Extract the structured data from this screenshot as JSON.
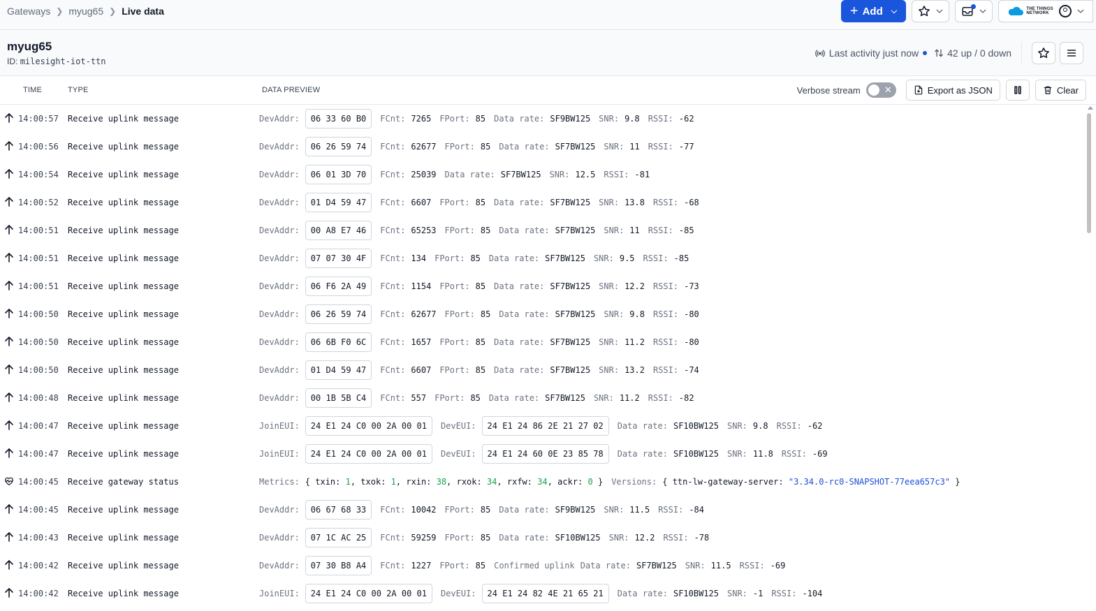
{
  "breadcrumb": {
    "items": [
      "Gateways",
      "myug65"
    ],
    "current": "Live data"
  },
  "topbar": {
    "add_label": "Add",
    "brand_text_line1": "THE THINGS",
    "brand_text_line2": "NETWORK"
  },
  "gateway": {
    "name": "myug65",
    "id_label": "ID:",
    "id_value": "milesight-iot-ttn"
  },
  "status": {
    "activity": "Last activity just now",
    "traffic": "42 up / 0 down"
  },
  "table": {
    "headers": {
      "time": "TIME",
      "type": "TYPE",
      "preview": "DATA PREVIEW"
    },
    "verbose_label": "Verbose stream",
    "verbose_enabled": false,
    "export_label": "Export as JSON",
    "clear_label": "Clear"
  },
  "rows": [
    {
      "time": "14:00:57",
      "type": "Receive uplink message",
      "icon": "arrow-up-icon",
      "kind": "dev",
      "devaddr": "06 33 60 B0",
      "fcnt": "7265",
      "fport": "85",
      "confirmed": false,
      "dr": "SF9BW125",
      "snr": "9.8",
      "rssi": "-62"
    },
    {
      "time": "14:00:56",
      "type": "Receive uplink message",
      "icon": "arrow-up-icon",
      "kind": "dev",
      "devaddr": "06 26 59 74",
      "fcnt": "62677",
      "fport": "85",
      "confirmed": false,
      "dr": "SF7BW125",
      "snr": "11",
      "rssi": "-77"
    },
    {
      "time": "14:00:54",
      "type": "Receive uplink message",
      "icon": "arrow-up-icon",
      "kind": "dev",
      "devaddr": "06 01 3D 70",
      "fcnt": "25039",
      "fport": "",
      "confirmed": false,
      "dr": "SF7BW125",
      "snr": "12.5",
      "rssi": "-81"
    },
    {
      "time": "14:00:52",
      "type": "Receive uplink message",
      "icon": "arrow-up-icon",
      "kind": "dev",
      "devaddr": "01 D4 59 47",
      "fcnt": "6607",
      "fport": "85",
      "confirmed": false,
      "dr": "SF7BW125",
      "snr": "13.8",
      "rssi": "-68"
    },
    {
      "time": "14:00:51",
      "type": "Receive uplink message",
      "icon": "arrow-up-icon",
      "kind": "dev",
      "devaddr": "00 A8 E7 46",
      "fcnt": "65253",
      "fport": "85",
      "confirmed": false,
      "dr": "SF7BW125",
      "snr": "11",
      "rssi": "-85"
    },
    {
      "time": "14:00:51",
      "type": "Receive uplink message",
      "icon": "arrow-up-icon",
      "kind": "dev",
      "devaddr": "07 07 30 4F",
      "fcnt": "134",
      "fport": "85",
      "confirmed": false,
      "dr": "SF7BW125",
      "snr": "9.5",
      "rssi": "-85"
    },
    {
      "time": "14:00:51",
      "type": "Receive uplink message",
      "icon": "arrow-up-icon",
      "kind": "dev",
      "devaddr": "06 F6 2A 49",
      "fcnt": "1154",
      "fport": "85",
      "confirmed": false,
      "dr": "SF7BW125",
      "snr": "12.2",
      "rssi": "-73"
    },
    {
      "time": "14:00:50",
      "type": "Receive uplink message",
      "icon": "arrow-up-icon",
      "kind": "dev",
      "devaddr": "06 26 59 74",
      "fcnt": "62677",
      "fport": "85",
      "confirmed": false,
      "dr": "SF7BW125",
      "snr": "9.8",
      "rssi": "-80"
    },
    {
      "time": "14:00:50",
      "type": "Receive uplink message",
      "icon": "arrow-up-icon",
      "kind": "dev",
      "devaddr": "06 6B F0 6C",
      "fcnt": "1657",
      "fport": "85",
      "confirmed": false,
      "dr": "SF7BW125",
      "snr": "11.2",
      "rssi": "-80"
    },
    {
      "time": "14:00:50",
      "type": "Receive uplink message",
      "icon": "arrow-up-icon",
      "kind": "dev",
      "devaddr": "01 D4 59 47",
      "fcnt": "6607",
      "fport": "85",
      "confirmed": false,
      "dr": "SF7BW125",
      "snr": "13.2",
      "rssi": "-74"
    },
    {
      "time": "14:00:48",
      "type": "Receive uplink message",
      "icon": "arrow-up-icon",
      "kind": "dev",
      "devaddr": "00 1B 5B C4",
      "fcnt": "557",
      "fport": "85",
      "confirmed": false,
      "dr": "SF7BW125",
      "snr": "11.2",
      "rssi": "-82"
    },
    {
      "time": "14:00:47",
      "type": "Receive uplink message",
      "icon": "arrow-up-icon",
      "kind": "join",
      "joineui": "24 E1 24 C0 00 2A 00 01",
      "deveui": "24 E1 24 86 2E 21 27 02",
      "dr": "SF10BW125",
      "snr": "9.8",
      "rssi": "-62"
    },
    {
      "time": "14:00:47",
      "type": "Receive uplink message",
      "icon": "arrow-up-icon",
      "kind": "join",
      "joineui": "24 E1 24 C0 00 2A 00 01",
      "deveui": "24 E1 24 60 0E 23 85 78",
      "dr": "SF10BW125",
      "snr": "11.8",
      "rssi": "-69"
    },
    {
      "time": "14:00:45",
      "type": "Receive gateway status",
      "icon": "heart-pulse-icon",
      "kind": "status",
      "metrics": [
        {
          "k": "txin",
          "v": "1"
        },
        {
          "k": "txok",
          "v": "1"
        },
        {
          "k": "rxin",
          "v": "38"
        },
        {
          "k": "rxok",
          "v": "34"
        },
        {
          "k": "rxfw",
          "v": "34"
        },
        {
          "k": "ackr",
          "v": "0"
        }
      ],
      "versions_key": "ttn-lw-gateway-server",
      "versions_value": "\"3.34.0-rc0-SNAPSHOT-77eea657c3\""
    },
    {
      "time": "14:00:45",
      "type": "Receive uplink message",
      "icon": "arrow-up-icon",
      "kind": "dev",
      "devaddr": "06 67 68 33",
      "fcnt": "10042",
      "fport": "85",
      "confirmed": false,
      "dr": "SF9BW125",
      "snr": "11.5",
      "rssi": "-84"
    },
    {
      "time": "14:00:43",
      "type": "Receive uplink message",
      "icon": "arrow-up-icon",
      "kind": "dev",
      "devaddr": "07 1C AC 25",
      "fcnt": "59259",
      "fport": "85",
      "confirmed": false,
      "dr": "SF10BW125",
      "snr": "12.2",
      "rssi": "-78"
    },
    {
      "time": "14:00:42",
      "type": "Receive uplink message",
      "icon": "arrow-up-icon",
      "kind": "dev",
      "devaddr": "07 30 B8 A4",
      "fcnt": "1227",
      "fport": "85",
      "confirmed": true,
      "dr": "SF7BW125",
      "snr": "11.5",
      "rssi": "-69"
    },
    {
      "time": "14:00:42",
      "type": "Receive uplink message",
      "icon": "arrow-up-icon",
      "kind": "join",
      "joineui": "24 E1 24 C0 00 2A 00 01",
      "deveui": "24 E1 24 82 4E 21 65 21",
      "dr": "SF10BW125",
      "snr": "-1",
      "rssi": "-104"
    }
  ],
  "labels": {
    "devaddr": "DevAddr:",
    "fcnt": "FCnt:",
    "fport": "FPort:",
    "dr": "Data rate:",
    "snr": "SNR:",
    "rssi": "RSSI:",
    "joineui": "JoinEUI:",
    "deveui": "DevEUI:",
    "metrics": "Metrics:",
    "versions": "Versions:",
    "confirmed": "Confirmed uplink"
  }
}
